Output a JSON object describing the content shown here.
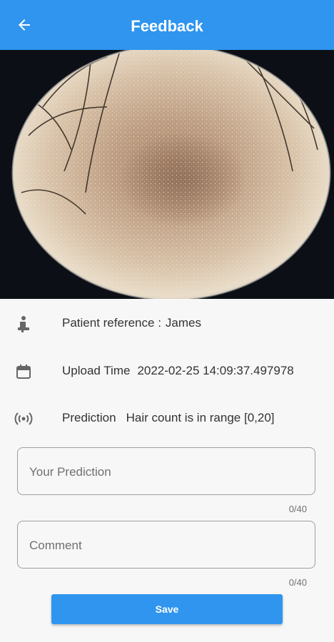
{
  "appbar": {
    "title": "Feedback",
    "back_icon": "arrow-left-icon",
    "color": "#2f95ee"
  },
  "info": {
    "patient_label": "Patient reference :",
    "patient_value": "James",
    "upload_label": "Upload Time",
    "upload_value": "2022-02-25 14:09:37.497978",
    "prediction_label": "Prediction",
    "prediction_value": "Hair count is in range [0,20]"
  },
  "form": {
    "prediction_placeholder": "Your Prediction",
    "prediction_counter": "0/40",
    "comment_placeholder": "Comment",
    "comment_counter": "0/40",
    "save_label": "Save"
  }
}
